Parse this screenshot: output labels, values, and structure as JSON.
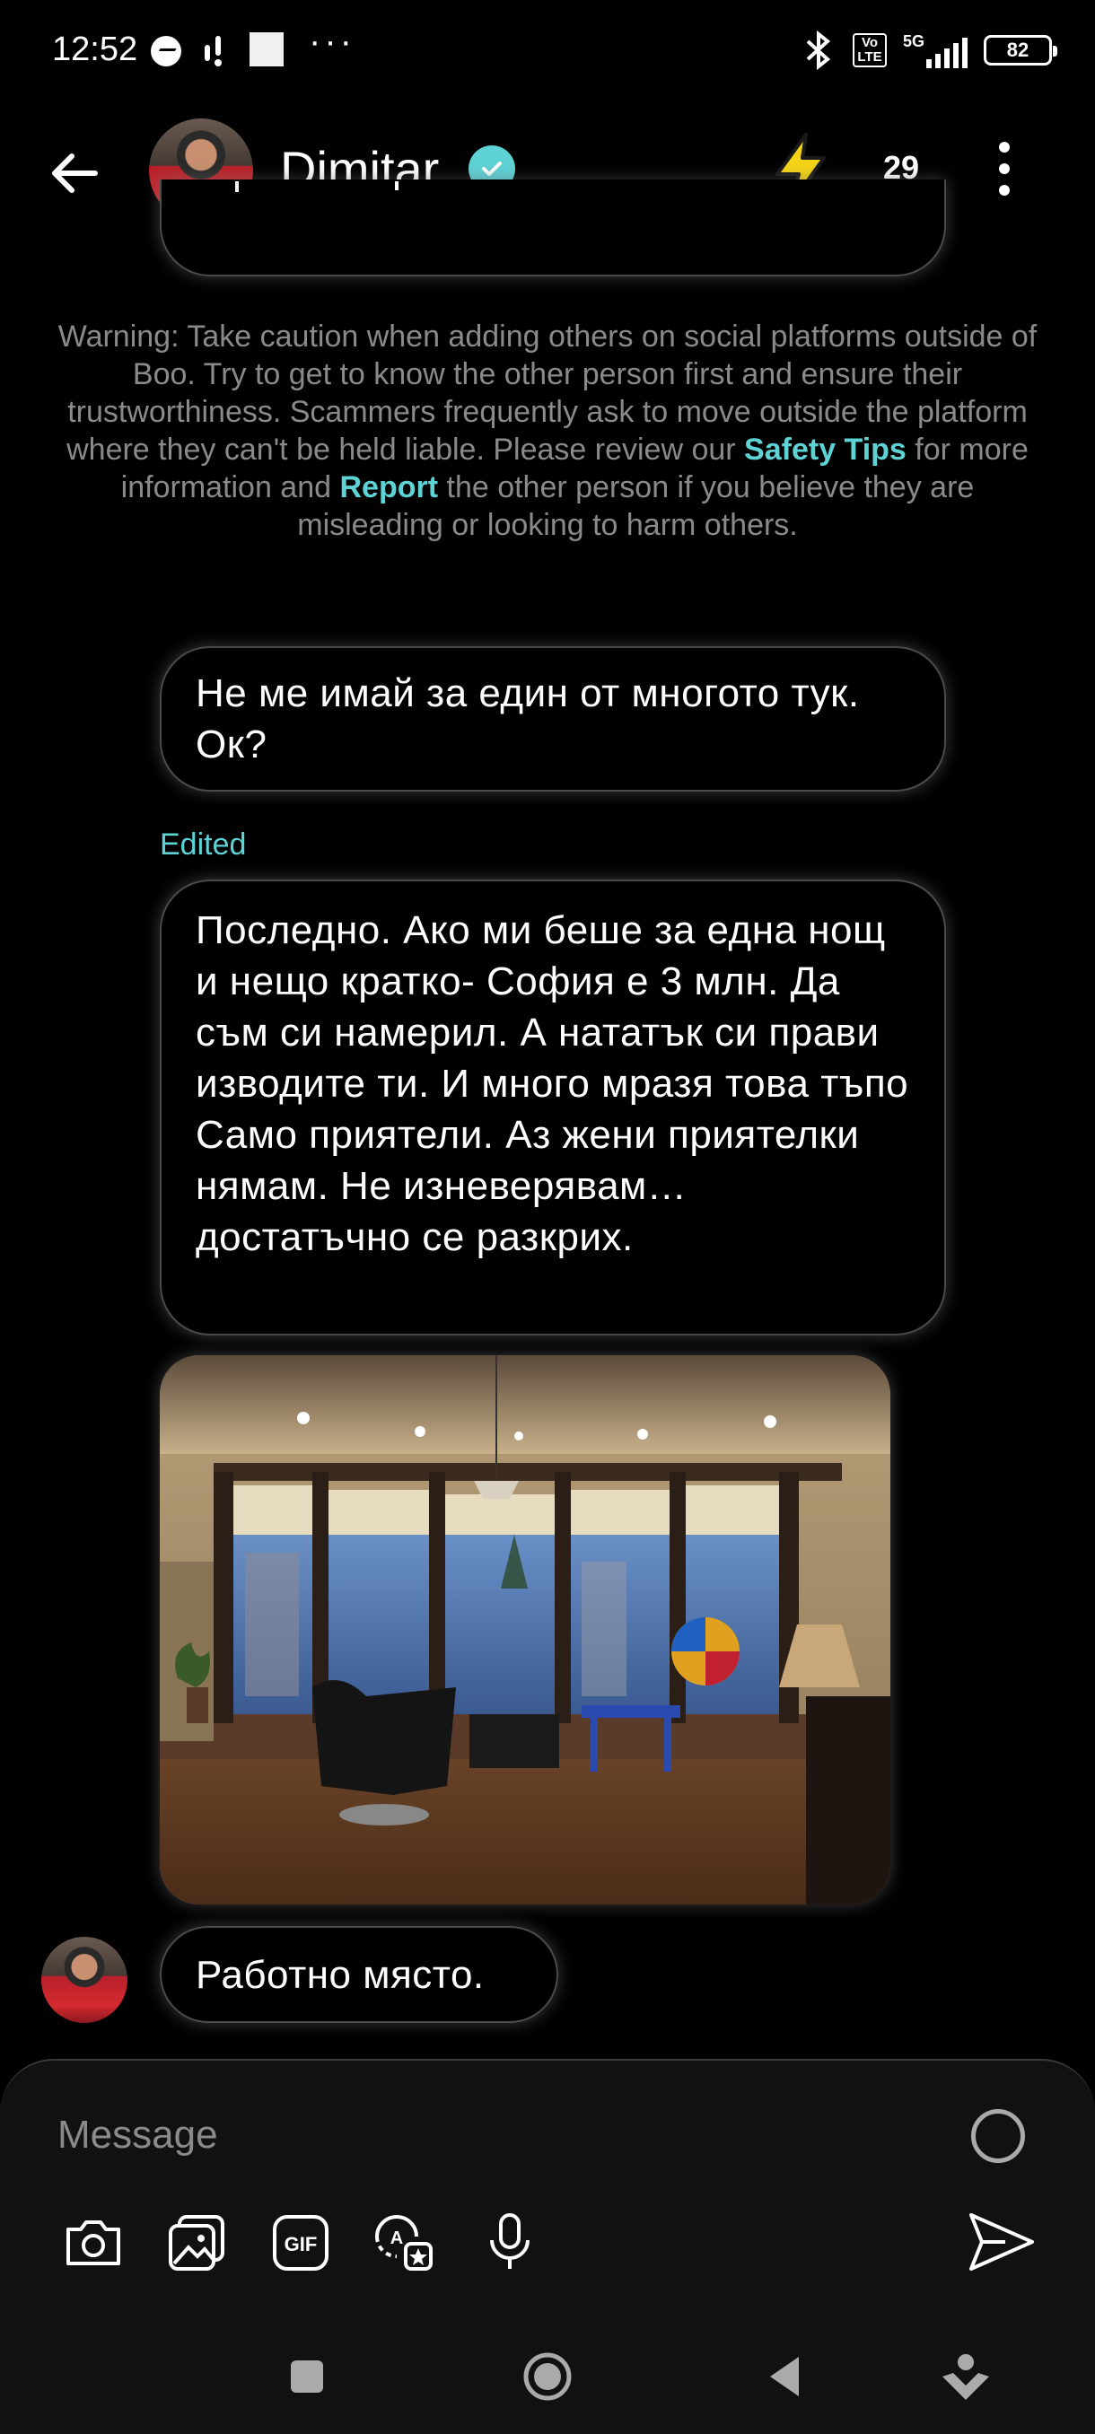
{
  "status_bar": {
    "time": "12:52",
    "dots": "···",
    "network": "5G",
    "volte": "Vo LTE",
    "battery": "82"
  },
  "header": {
    "contact_name": "Dimitar",
    "coins": "29"
  },
  "warning": {
    "part1": "Warning: Take caution when adding others on social platforms outside of Boo. Try to get to know the other person first and ensure their trustworthiness. Scammers frequently ask to move outside the platform where they can't be held liable. Please review our ",
    "safety_tips": "Safety Tips",
    "part2": " for more information and ",
    "report": "Report",
    "part3": " the other person if you believe they are misleading or looking to harm others."
  },
  "messages": [
    {
      "text": "Не ме имай за един от многото тук. Ок?"
    },
    {
      "edited_label": "Edited",
      "text": "Последно. Ако ми беше за една нощ и нещо кратко- София е 3 млн. Да съм си намерил. А нататък си прави изводите ти. И много мразя това тъпо Само приятели. Аз жени приятелки нямам. Не изневерявам… достатъчно се разкрих."
    },
    {
      "text": "Работно място."
    }
  ],
  "composer": {
    "placeholder": "Message"
  },
  "colors": {
    "accent": "#5ed3d6",
    "background": "#000000",
    "bolt": "#f5d416"
  }
}
